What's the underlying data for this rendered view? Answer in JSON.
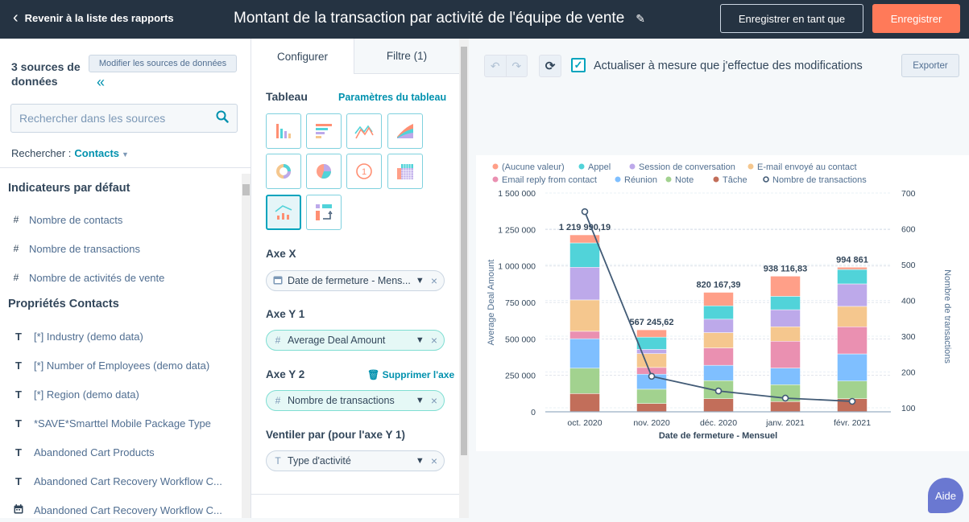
{
  "header": {
    "back_label": "Revenir à la liste des rapports",
    "title": "Montant de la transaction par activité de l'équipe de vente",
    "save_as_label": "Enregistrer en tant que",
    "save_label": "Enregistrer"
  },
  "sources": {
    "title": "3 sources de données",
    "modify_label": "Modifier les sources de données",
    "search_placeholder": "Rechercher dans les sources",
    "search_by_label": "Rechercher :",
    "search_by_value": "Contacts",
    "sections": [
      {
        "heading": "Indicateurs par défaut",
        "items": [
          {
            "icon": "#",
            "label": "Nombre de contacts"
          },
          {
            "icon": "#",
            "label": "Nombre de transactions"
          },
          {
            "icon": "#",
            "label": "Nombre de activités de vente"
          }
        ]
      },
      {
        "heading": "Propriétés Contacts",
        "items": [
          {
            "icon": "T",
            "label": "[*] Industry (demo data)"
          },
          {
            "icon": "T",
            "label": "[*] Number of Employees (demo data)"
          },
          {
            "icon": "T",
            "label": "[*] Region (demo data)"
          },
          {
            "icon": "T",
            "label": "*SAVE*Smarttel Mobile Package Type"
          },
          {
            "icon": "T",
            "label": "Abandoned Cart Products"
          },
          {
            "icon": "T",
            "label": "Abandoned Cart Recovery Workflow C..."
          },
          {
            "icon": "calendar",
            "label": "Abandoned Cart Recovery Workflow C..."
          }
        ]
      }
    ]
  },
  "config": {
    "tabs": [
      {
        "label": "Configurer",
        "active": true
      },
      {
        "label": "Filtre (1)",
        "active": false
      }
    ],
    "chart_heading": "Tableau",
    "chart_params_label": "Paramètres du tableau",
    "chart_types": [
      "vertical-bar",
      "horizontal-bar",
      "line",
      "area",
      "donut",
      "pie",
      "summary",
      "pivot",
      "combination",
      "sankey"
    ],
    "selected_chart_type": "combination",
    "x_axis": {
      "heading": "Axe X",
      "value": "Date de fermeture - Mens..."
    },
    "y1_axis": {
      "heading": "Axe Y 1",
      "value": "Average Deal Amount"
    },
    "y2_axis": {
      "heading": "Axe Y 2",
      "value": "Nombre de transactions",
      "delete_label": "Supprimer l'axe"
    },
    "breakdown": {
      "heading": "Ventiler par (pour l'axe Y 1)",
      "value": "Type d'activité"
    }
  },
  "toolbar": {
    "auto_refresh_label": "Actualiser à mesure que j'effectue des modifications",
    "auto_refresh_checked": true,
    "export_label": "Exporter"
  },
  "help_label": "Aide",
  "chart_data": {
    "type": "bar",
    "stacked": true,
    "secondary_type": "line",
    "categories": [
      "oct. 2020",
      "nov. 2020",
      "déc. 2020",
      "janv. 2021",
      "févr. 2021"
    ],
    "xlabel": "Date de fermeture - Mensuel",
    "ylabel": "Average Deal Amount",
    "y2label": "Nombre de transactions",
    "ylim": [
      0,
      1500000
    ],
    "y2lim": [
      100,
      700
    ],
    "yticks": [
      "0",
      "250 000",
      "500 000",
      "750 000",
      "1 000 000",
      "1 250 000",
      "1 500 000"
    ],
    "y2ticks": [
      "100",
      "200",
      "300",
      "400",
      "500",
      "600",
      "700"
    ],
    "grid": true,
    "legend_position": "top-left",
    "totals": [
      "1 219 990,19",
      "567 245,62",
      "820 167,39",
      "938 116,83",
      "994 861"
    ],
    "series": [
      {
        "name": "Tâche",
        "color": "#c26e5a",
        "values": [
          125000,
          57000,
          90000,
          70000,
          90000
        ]
      },
      {
        "name": "Note",
        "color": "#a2d28f",
        "values": [
          174000,
          98000,
          124000,
          116000,
          121000
        ]
      },
      {
        "name": "Réunion",
        "color": "#7fbfff",
        "values": [
          202000,
          103000,
          105000,
          114000,
          186000
        ]
      },
      {
        "name": "Email reply from contact",
        "color": "#ea90b1",
        "values": [
          51000,
          46000,
          119000,
          184000,
          186000
        ]
      },
      {
        "name": "E-mail envoyé au contact",
        "color": "#f5c78e",
        "values": [
          215000,
          95000,
          105000,
          99000,
          140000
        ]
      },
      {
        "name": "Session de conversation",
        "color": "#bda9ea",
        "values": [
          224000,
          29000,
          92000,
          117000,
          154000
        ]
      },
      {
        "name": "Appel",
        "color": "#51d3d9",
        "values": [
          167000,
          84000,
          92000,
          92000,
          99000
        ]
      },
      {
        "name": "(Aucune valeur)",
        "color": "#ff9f88",
        "values": [
          55000,
          50000,
          92000,
          138000,
          15000
        ]
      }
    ],
    "legend_order": [
      "(Aucune valeur)",
      "Appel",
      "Session de conversation",
      "E-mail envoyé au contact",
      "Email reply from contact",
      "Réunion",
      "Note",
      "Tâche",
      "Nombre de transactions"
    ],
    "line_series": {
      "name": "Nombre de transactions",
      "color": "#425b76",
      "axis": "right",
      "values": [
        648,
        188,
        147,
        127,
        118
      ]
    }
  }
}
